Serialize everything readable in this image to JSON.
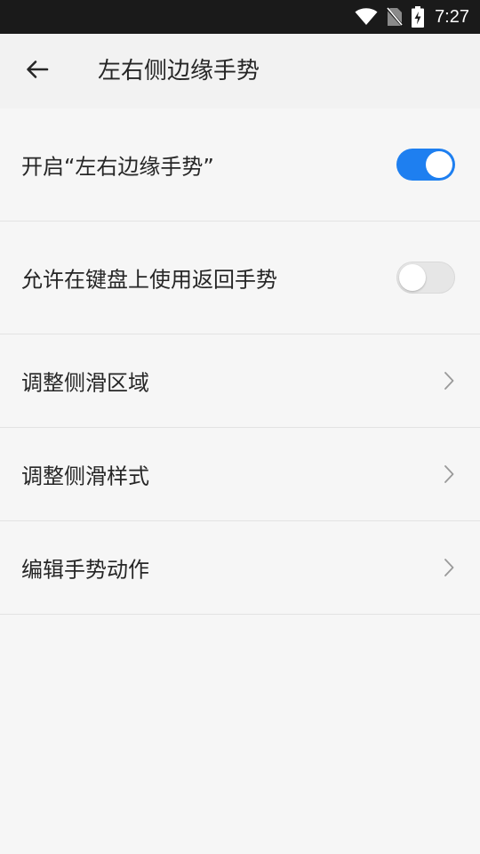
{
  "status_bar": {
    "time": "7:27",
    "icons": [
      "wifi-icon",
      "no-sim-icon",
      "battery-charging-icon"
    ]
  },
  "app_bar": {
    "back_icon": "arrow-left-icon",
    "title": "左右侧边缘手势"
  },
  "settings": {
    "items": [
      {
        "label": "开启“左右边缘手势”",
        "control": "toggle",
        "enabled": true
      },
      {
        "label": "允许在键盘上使用返回手势",
        "control": "toggle",
        "enabled": false
      },
      {
        "label": "调整侧滑区域",
        "control": "chevron",
        "icon": "chevron-right-icon"
      },
      {
        "label": "调整侧滑样式",
        "control": "chevron",
        "icon": "chevron-right-icon"
      },
      {
        "label": "编辑手势动作",
        "control": "chevron",
        "icon": "chevron-right-icon"
      }
    ]
  },
  "colors": {
    "accent": "#1e7ff0",
    "background": "#f6f6f6",
    "status_bar": "#1a1a1a",
    "text": "#262626",
    "divider": "#e3e3e3"
  }
}
